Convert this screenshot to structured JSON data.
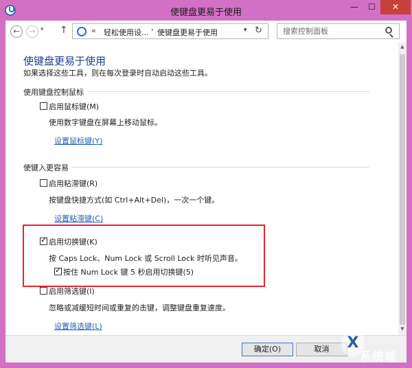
{
  "window": {
    "title": "使键盘更易于使用",
    "minimize_glyph": "—",
    "maximize_glyph": "☐",
    "close_glyph": "✕",
    "accent_color": "#d270c6",
    "close_color": "#c7403a"
  },
  "nav": {
    "back_glyph": "←",
    "forward_glyph": "→",
    "recent_glyph": "▾",
    "up_glyph": "↑",
    "address": {
      "prefix": "«",
      "crumbs": [
        "轻松使用设...",
        "使键盘更易于使用"
      ],
      "separator_glyph": "›",
      "dropdown_glyph": "▾",
      "refresh_glyph": "↻"
    },
    "search": {
      "placeholder": "搜索控制面板"
    }
  },
  "page": {
    "title": "使键盘更易于使用",
    "description": "如果选择这些工具，则在每次登录时自动启动这些工具。",
    "mouse_group": {
      "label": "使用键盘控制鼠标",
      "mouse_keys": {
        "label": "启用鼠标键(M)",
        "checked": false,
        "description": "使用数字键盘在屏幕上移动鼠标。",
        "link": "设置鼠标键(Y)"
      }
    },
    "typing_group": {
      "label": "使键入更容易",
      "sticky_keys": {
        "label": "启用粘滞键(R)",
        "checked": false,
        "description": "按键盘快捷方式(如 Ctrl+Alt+Del)，一次一个键。",
        "link": "设置粘滞键(C)"
      },
      "toggle_keys": {
        "label": "启用切换键(K)",
        "checked": true,
        "description": "按 Caps Lock、Num Lock 或 Scroll Lock 时听见声音。",
        "sub_option": {
          "label": "按住 Num Lock 键 5 秒启用切换键(5)",
          "checked": true
        }
      },
      "filter_keys": {
        "label": "启用筛选键(I)",
        "checked": false,
        "description": "忽略或减缓短时间或重复的击键，调整键盘重复速度。",
        "link": "设置筛选键(L)"
      }
    }
  },
  "footer": {
    "ok_label": "确定(O)",
    "cancel_label": "取消"
  },
  "watermark": {
    "logo_glyph": "X",
    "text": "系统城"
  },
  "colors": {
    "link": "#2460b8",
    "heading": "#1b3e8e",
    "highlight_border": "#e8242c"
  }
}
